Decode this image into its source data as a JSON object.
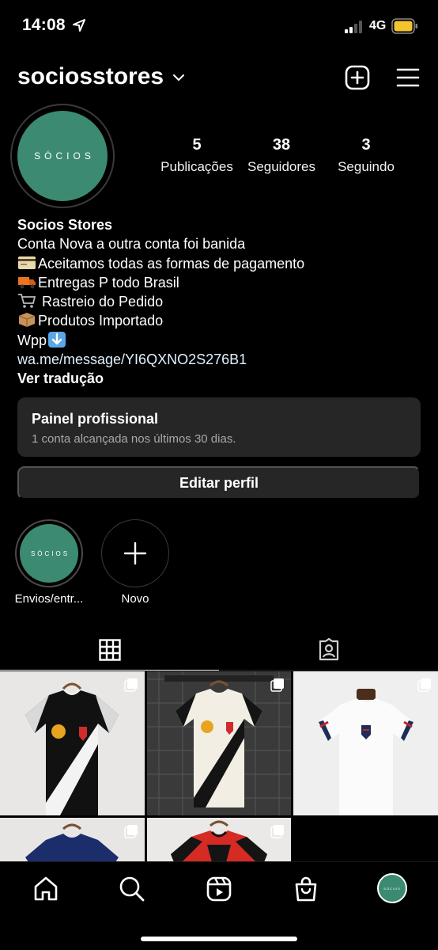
{
  "status_bar": {
    "time": "14:08",
    "network": "4G"
  },
  "header": {
    "username": "sociosstores"
  },
  "avatar": {
    "text": "SÓCIOS"
  },
  "stats": [
    {
      "value": "5",
      "label": "Publicações"
    },
    {
      "value": "38",
      "label": "Seguidores"
    },
    {
      "value": "3",
      "label": "Seguindo"
    }
  ],
  "bio": {
    "name": "Socios Stores",
    "lines": [
      "Conta Nova a outra conta foi banida",
      "Aceitamos todas as formas de pagamento",
      "Entregas P todo Brasil",
      " Rastreio do Pedido",
      "Produtos Importado",
      "Wpp"
    ],
    "link": "wa.me/message/YI6QXNO2S276B1",
    "translate": "Ver tradução"
  },
  "professional_panel": {
    "title": "Painel profissional",
    "subtitle": "1 conta alcançada nos últimos 30 dias."
  },
  "edit_profile": {
    "label": "Editar perfil"
  },
  "highlights": [
    {
      "label": "Envios/entr...",
      "cover_text": "SÓCIOS"
    },
    {
      "label": "Novo"
    }
  ],
  "tabs": [
    {
      "icon": "grid-icon",
      "active": true
    },
    {
      "icon": "tagged-icon",
      "active": false
    }
  ],
  "posts": [
    {
      "subject": "vasco-black-jersey",
      "multiple": true
    },
    {
      "subject": "vasco-white-jersey",
      "multiple": true
    },
    {
      "subject": "usa-white-jersey",
      "multiple": true
    },
    {
      "subject": "navy-jersey",
      "multiple": true
    },
    {
      "subject": "red-black-jersey",
      "multiple": true
    }
  ],
  "bottom_nav": [
    {
      "icon": "home-icon"
    },
    {
      "icon": "search-icon"
    },
    {
      "icon": "reels-icon"
    },
    {
      "icon": "shop-icon"
    },
    {
      "icon": "profile-avatar"
    }
  ],
  "colors": {
    "background": "#000000",
    "card": "#262626",
    "brand_green": "#3c8a72",
    "battery": "#f4c430"
  }
}
